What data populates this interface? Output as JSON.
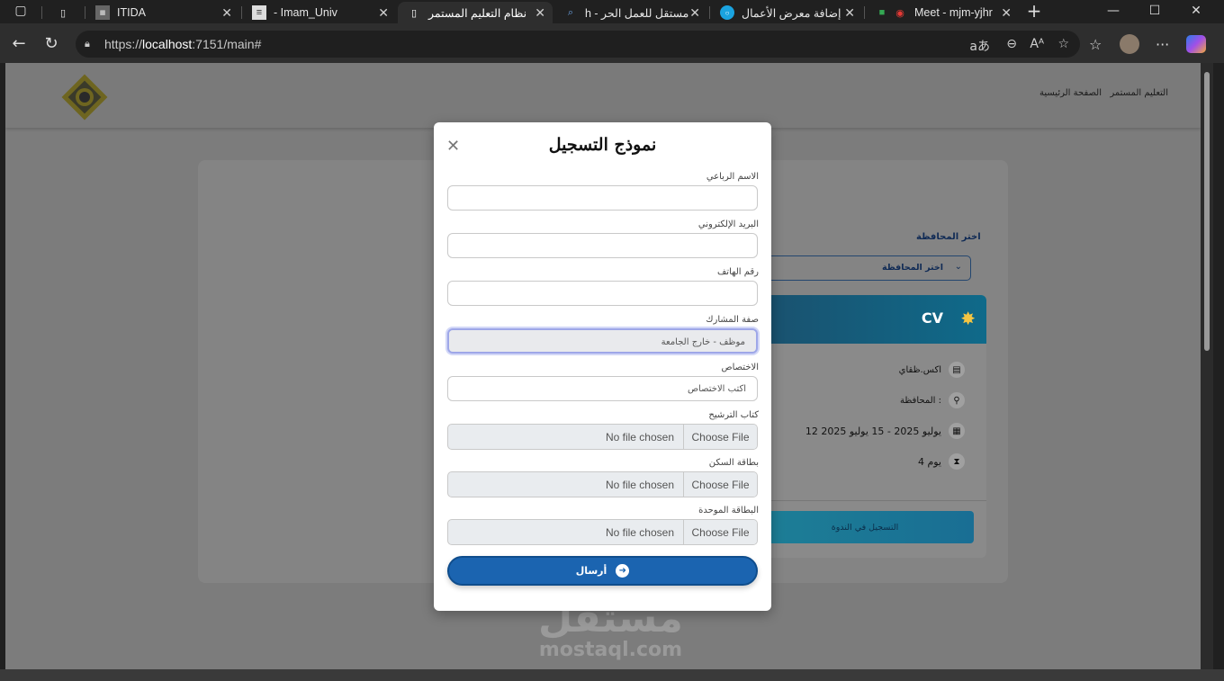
{
  "browser": {
    "tabs": [
      {
        "label": "",
        "icon": "page-icon"
      },
      {
        "label": "ITIDA",
        "icon": "itida-icon"
      },
      {
        "label": "Imam_Univ -",
        "icon": "doc-icon"
      },
      {
        "label": "نظام التعليم المستمر",
        "icon": "page-icon",
        "active": true
      },
      {
        "label": "مستقل للعمل الحر - h",
        "icon": "search-icon"
      },
      {
        "label": "إضافة معرض الأعمال",
        "icon": "mostaql-icon"
      },
      {
        "label": "Meet - mjm-yjhr",
        "icon": "meet-icon"
      }
    ],
    "url_prefix": "https://",
    "url_host": "localhost",
    "url_rest": ":7151/main#"
  },
  "site": {
    "nav": [
      "التعليم المستمر",
      "الصفحة الرئيسية"
    ],
    "gov_label": "اختر المحافظة",
    "gov_select_value": "اختر المحافظة",
    "course": {
      "title": "CV",
      "program_label": "اكس.ظقاي",
      "governorate_label": "المحافظة :",
      "dates": "12 يوليو 2025 - 15 يوليو 2025",
      "duration": "4 يوم",
      "register_button": "التسجيل في الندوة"
    }
  },
  "modal": {
    "title": "نموذج التسجيل",
    "fields": {
      "full_name_label": "الاسم الرباعي",
      "email_label": "البريد الإلكتروني",
      "phone_label": "رقم الهاتف",
      "participant_type_label": "صفة المشارك",
      "participant_type_value": "موظف - خارج الجامعة",
      "specialization_label": "الاختصاص",
      "specialization_placeholder": "اكتب الاختصاص",
      "nomination_letter_label": "كتاب الترشيح",
      "residence_card_label": "بطاقة السكن",
      "unified_card_label": "البطاقة الموحدة"
    },
    "file_choose": "Choose File",
    "file_none": "No file chosen",
    "submit_label": "أرسال"
  },
  "watermark": {
    "arabic": "مستقل",
    "latin": "mostaql.com"
  }
}
